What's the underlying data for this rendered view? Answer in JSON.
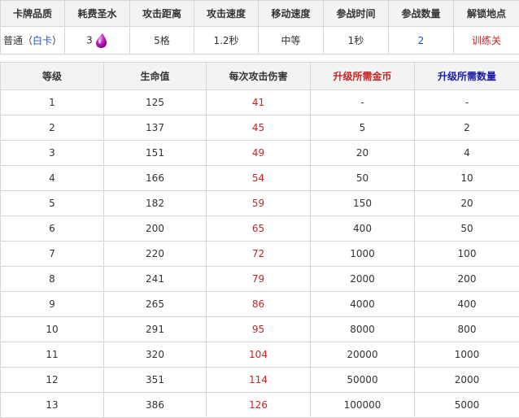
{
  "info": {
    "headers": [
      "卡牌品质",
      "耗费圣水",
      "攻击距离",
      "攻击速度",
      "移动速度",
      "参战时间",
      "参战数量",
      "解锁地点"
    ],
    "quality_prefix": "普通（",
    "quality_link": "白卡",
    "quality_suffix": "）",
    "elixir_cost": "3",
    "elixir_icon": "elixir-drop-icon",
    "range": "5格",
    "attack_speed": "1.2秒",
    "move_speed": "中等",
    "deploy_time": "1秒",
    "count": "2",
    "unlock": "训练关",
    "colors": {
      "link_red": "#cc2222",
      "link_blue": "#1a4fd6"
    }
  },
  "stats": {
    "headers": [
      "等级",
      "生命值",
      "每次攻击伤害",
      "升级所需金币",
      "升级所需数量"
    ],
    "header_colors": {
      "gold": "#cc2222",
      "cards": "#1a1aa6"
    },
    "rows": [
      [
        "1",
        "125",
        "41",
        "-",
        "-"
      ],
      [
        "2",
        "137",
        "45",
        "5",
        "2"
      ],
      [
        "3",
        "151",
        "49",
        "20",
        "4"
      ],
      [
        "4",
        "166",
        "54",
        "50",
        "10"
      ],
      [
        "5",
        "182",
        "59",
        "150",
        "20"
      ],
      [
        "6",
        "200",
        "65",
        "400",
        "50"
      ],
      [
        "7",
        "220",
        "72",
        "1000",
        "100"
      ],
      [
        "8",
        "241",
        "79",
        "2000",
        "200"
      ],
      [
        "9",
        "265",
        "86",
        "4000",
        "400"
      ],
      [
        "10",
        "291",
        "95",
        "8000",
        "800"
      ],
      [
        "11",
        "320",
        "104",
        "20000",
        "1000"
      ],
      [
        "12",
        "351",
        "114",
        "50000",
        "2000"
      ],
      [
        "13",
        "386",
        "126",
        "100000",
        "5000"
      ]
    ]
  }
}
